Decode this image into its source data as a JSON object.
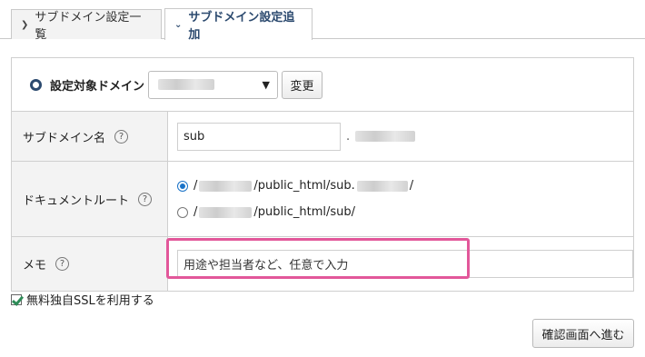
{
  "tabs": {
    "list_label": "サブドメイン設定一覧",
    "add_label": "サブドメイン設定追加"
  },
  "domain_row": {
    "label": "設定対象ドメイン",
    "change_button": "変更"
  },
  "subdomain_row": {
    "label": "サブドメイン名",
    "help": "?",
    "value": "sub",
    "separator": "."
  },
  "docroot_row": {
    "label": "ドキュメントルート",
    "help": "?",
    "option1_mid": "/public_html/sub.",
    "option1_end": "/",
    "option2_mid": "/public_html/sub/"
  },
  "memo_row": {
    "label": "メモ",
    "help": "?",
    "placeholder": "用途や担当者など、任意で入力"
  },
  "ssl_checkbox": "無料独自SSLを利用する",
  "next_button": "確認画面へ進む",
  "colors": {
    "accent": "#2c4a6f",
    "highlight": "#e2579a",
    "radio": "#1a73c8",
    "check": "#2e8b57"
  }
}
